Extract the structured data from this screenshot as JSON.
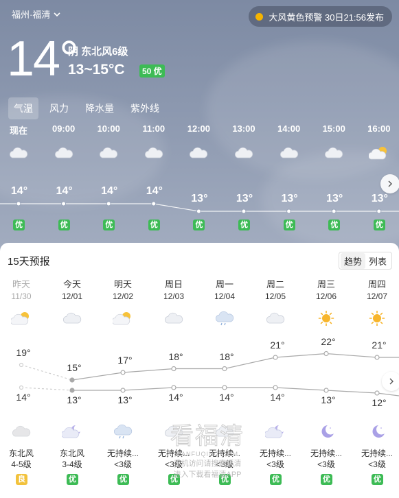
{
  "location": "福州·福清",
  "warning": "大风黄色预警 30日21:56发布",
  "current": {
    "temp": "14°",
    "condition": "阴 东北风6级",
    "range": "13~15°C",
    "aqi": "50 优"
  },
  "tabs": [
    "气温",
    "风力",
    "降水量",
    "紫外线"
  ],
  "hourly": [
    {
      "time": "现在",
      "icon": "cloudy-icon",
      "temp": "14°",
      "aqi": "优",
      "value": 14
    },
    {
      "time": "09:00",
      "icon": "cloudy-icon",
      "temp": "14°",
      "aqi": "优",
      "value": 14
    },
    {
      "time": "10:00",
      "icon": "cloudy-icon",
      "temp": "14°",
      "aqi": "优",
      "value": 14
    },
    {
      "time": "11:00",
      "icon": "cloudy-icon",
      "temp": "14°",
      "aqi": "优",
      "value": 14
    },
    {
      "time": "12:00",
      "icon": "cloudy-icon",
      "temp": "13°",
      "aqi": "优",
      "value": 13
    },
    {
      "time": "13:00",
      "icon": "cloudy-icon",
      "temp": "13°",
      "aqi": "优",
      "value": 13
    },
    {
      "time": "14:00",
      "icon": "cloudy-icon",
      "temp": "13°",
      "aqi": "优",
      "value": 13
    },
    {
      "time": "15:00",
      "icon": "cloudy-icon",
      "temp": "13°",
      "aqi": "优",
      "value": 13
    },
    {
      "time": "16:00",
      "icon": "partly-sunny-icon",
      "temp": "13°",
      "aqi": "优",
      "value": 13
    }
  ],
  "forecast_title": "15天预报",
  "view_toggle": [
    "趋势",
    "列表"
  ],
  "daily": [
    {
      "name": "昨天",
      "date": "11/30",
      "day_icon": "partly-sunny-icon",
      "high": "19°",
      "low": "14°",
      "hi": 19,
      "lo": 14,
      "night_icon": "cloudy-icon",
      "wind1": "东北风",
      "wind2": "4-5级",
      "aqi": "良",
      "past": true
    },
    {
      "name": "今天",
      "date": "12/01",
      "day_icon": "cloudy-icon",
      "high": "15°",
      "low": "13°",
      "hi": 15,
      "lo": 13,
      "night_icon": "cloudy-moon-icon",
      "wind1": "东北风",
      "wind2": "3-4级",
      "aqi": "优",
      "past": false
    },
    {
      "name": "明天",
      "date": "12/02",
      "day_icon": "partly-sunny-icon",
      "high": "17°",
      "low": "13°",
      "hi": 17,
      "lo": 13,
      "night_icon": "rain-icon",
      "wind1": "无持续...",
      "wind2": "<3级",
      "aqi": "优",
      "past": false
    },
    {
      "name": "周日",
      "date": "12/03",
      "day_icon": "cloudy-icon",
      "high": "18°",
      "low": "14°",
      "hi": 18,
      "lo": 14,
      "night_icon": "cloudy-icon",
      "wind1": "无持续...",
      "wind2": "<3级",
      "aqi": "优",
      "past": false
    },
    {
      "name": "周一",
      "date": "12/04",
      "day_icon": "rain-icon",
      "high": "18°",
      "low": "14°",
      "hi": 18,
      "lo": 14,
      "night_icon": "cloudy-icon",
      "wind1": "无持续...",
      "wind2": "<3级",
      "aqi": "优",
      "past": false
    },
    {
      "name": "周二",
      "date": "12/05",
      "day_icon": "cloudy-icon",
      "high": "21°",
      "low": "14°",
      "hi": 21,
      "lo": 14,
      "night_icon": "cloudy-moon-icon",
      "wind1": "无持续...",
      "wind2": "<3级",
      "aqi": "优",
      "past": false
    },
    {
      "name": "周三",
      "date": "12/06",
      "day_icon": "sunny-icon",
      "high": "22°",
      "low": "13°",
      "hi": 22,
      "lo": 13,
      "night_icon": "moon-icon",
      "wind1": "无持续...",
      "wind2": "<3级",
      "aqi": "优",
      "past": false
    },
    {
      "name": "周四",
      "date": "12/07",
      "day_icon": "sunny-icon",
      "high": "21°",
      "low": "12°",
      "hi": 21,
      "lo": 12,
      "night_icon": "moon-icon",
      "wind1": "无持续...",
      "wind2": "<3级",
      "aqi": "优",
      "past": false
    }
  ],
  "watermark": {
    "title": "看福清",
    "sub": "KANFUQING.COM",
    "line1": "手机访问请搜索福清",
    "line2": "进入下载看福清APP"
  }
}
